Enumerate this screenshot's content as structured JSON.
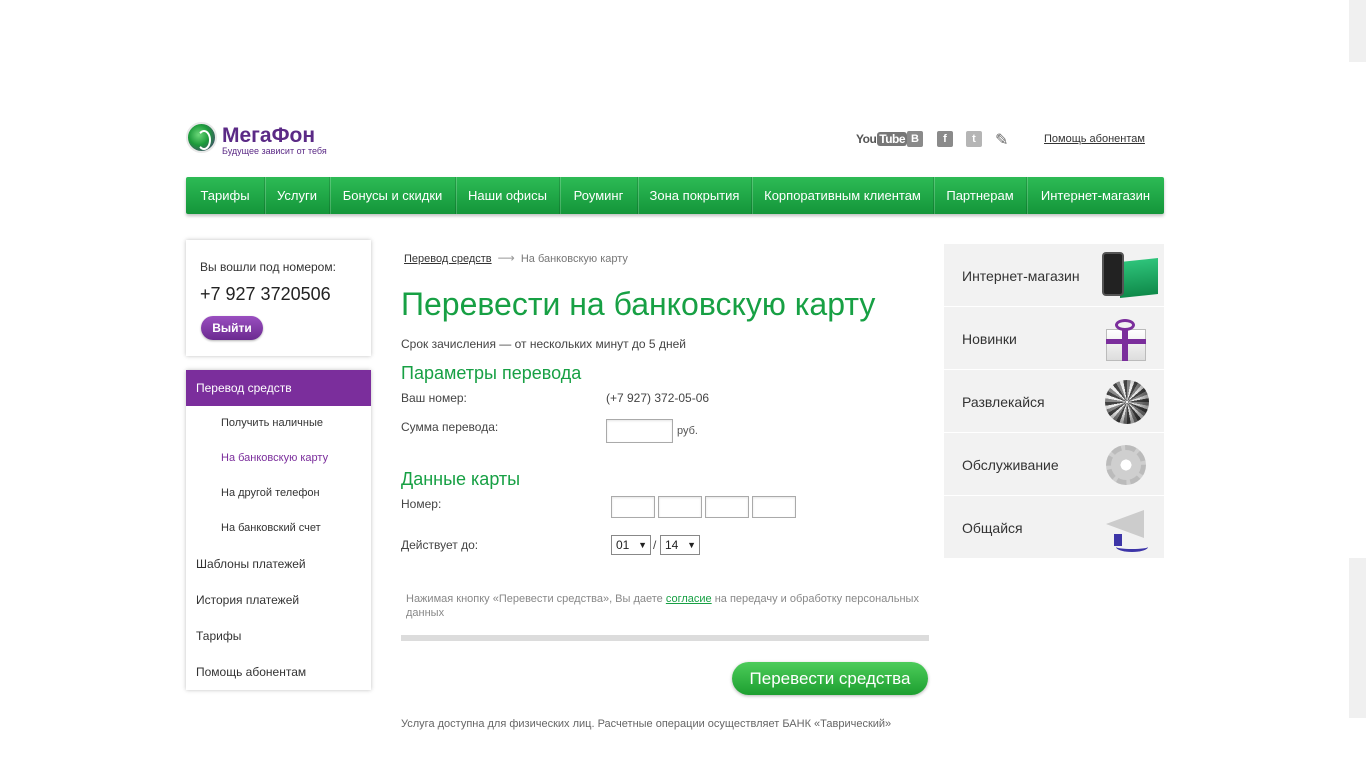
{
  "header": {
    "brand_name": "МегаФон",
    "brand_slogan": "Будущее зависит от тебя",
    "help_link": "Помощь абонентам",
    "social": {
      "youtube_text": "You",
      "youtube_box": "Tube",
      "vk": "B",
      "facebook": "f",
      "twitter": "t"
    }
  },
  "nav": {
    "items": [
      "Тарифы",
      "Услуги",
      "Бонусы и скидки",
      "Наши офисы",
      "Роуминг",
      "Зона покрытия",
      "Корпоративным клиентам",
      "Партнерам",
      "Интернет-магазин"
    ]
  },
  "login": {
    "label": "Вы вошли под номером:",
    "number": "+7 927 3720506",
    "logout": "Выйти"
  },
  "sidebar": {
    "active": "Перевод средств",
    "sub_items": [
      "Получить наличные",
      "На банковскую карту",
      "На другой телефон",
      "На банковский счет"
    ],
    "top_items": [
      "Шаблоны платежей",
      "История платежей",
      "Тарифы",
      "Помощь абонентам"
    ]
  },
  "breadcrumb": {
    "parent": "Перевод средств",
    "arrow": "⟶",
    "current": "На банковскую карту"
  },
  "content": {
    "title": "Перевести на банковскую карту",
    "subtitle": "Срок зачисления — от нескольких минут до 5 дней",
    "params_heading": "Параметры перевода",
    "your_number_label": "Ваш номер:",
    "your_number_value": "(+7 927) 372-05-06",
    "amount_label": "Сумма перевода:",
    "amount_value": "",
    "amount_unit": "руб.",
    "card_heading": "Данные карты",
    "card_number_label": "Номер:",
    "valid_until_label": "Действует до:",
    "month": "01",
    "year": "14",
    "slash": "/",
    "consent_prefix": "Нажимая кнопку «Перевести средства», Вы даете ",
    "consent_link": "согласие",
    "consent_suffix": " на передачу и обработку персональных данных",
    "submit": "Перевести средства",
    "footer_note": "Услуга доступна для физических лиц. Расчетные операции осуществляет БАНК «Таврический»"
  },
  "promo": {
    "items": [
      "Интернет-магазин",
      "Новинки",
      "Развлекайся",
      "Обслуживание",
      "Общайся"
    ]
  },
  "colors": {
    "brand_green": "#17a044",
    "brand_purple": "#7b2e9c"
  }
}
